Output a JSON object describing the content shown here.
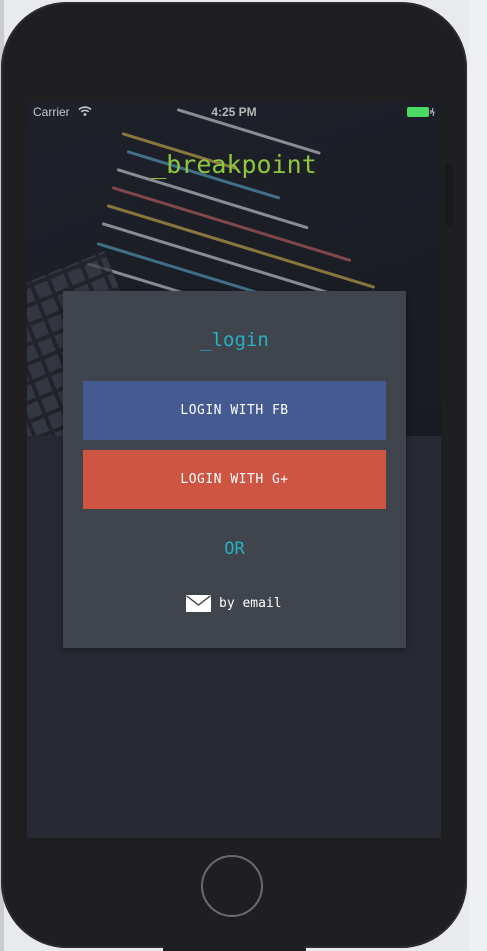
{
  "status_bar": {
    "carrier": "Carrier",
    "time": "4:25 PM",
    "wifi_icon": "wifi-icon",
    "battery_icon": "battery-icon",
    "battery_color": "#4cd964"
  },
  "app": {
    "title": "_breakpoint",
    "title_color": "#8ec640"
  },
  "login_card": {
    "title": "_login",
    "fb_button_label": "LOGIN WITH FB",
    "google_button_label": "LOGIN WITH G+",
    "or_label": "OR",
    "email_link_label": "by email",
    "email_icon": "envelope-icon",
    "accent_color": "#25b2c3",
    "fb_color": "#445a91",
    "google_color": "#cd5541"
  },
  "device": {
    "home_button_icon": "home-button"
  }
}
